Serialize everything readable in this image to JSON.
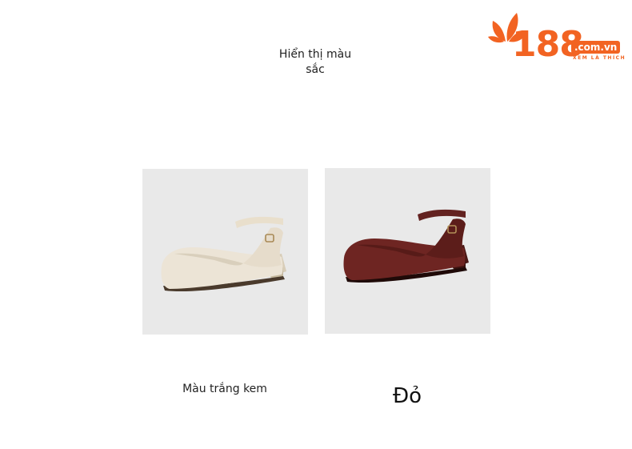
{
  "logo": {
    "number": "188",
    "domain": ".com.vn",
    "tagline": "XEM LÀ THÍCH",
    "brand_color": "#f26322"
  },
  "heading": "Hiển thị màu sắc",
  "swatches": [
    {
      "label": "Màu trắng kem",
      "shoe_color": "#ece4d6",
      "image_icon": "cream-shoe-icon"
    },
    {
      "label": "Đỏ",
      "shoe_color": "#6e2522",
      "image_icon": "burgundy-shoe-icon"
    }
  ]
}
